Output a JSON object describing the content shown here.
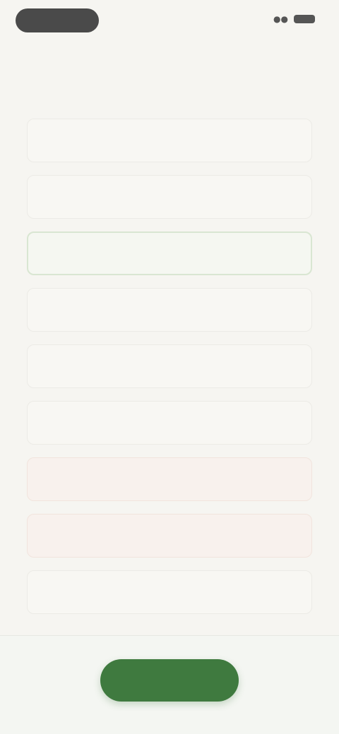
{
  "status_bar": {
    "pill_label": "",
    "time": "",
    "signal_icon": "signal-icon",
    "battery_icon": "battery-icon"
  },
  "question": "",
  "options": [
    {
      "icon": "",
      "icon_name": "option-icon",
      "label": ""
    },
    {
      "icon": "",
      "icon_name": "option-icon",
      "label": ""
    },
    {
      "icon": "",
      "icon_name": "option-icon",
      "label": ""
    },
    {
      "icon": "",
      "icon_name": "option-icon",
      "label": ""
    },
    {
      "icon": "",
      "icon_name": "option-icon",
      "label": ""
    },
    {
      "icon": "",
      "icon_name": "option-icon",
      "label": ""
    },
    {
      "icon": "",
      "icon_name": "option-icon",
      "label": ""
    },
    {
      "icon": "",
      "icon_name": "option-icon",
      "label": ""
    },
    {
      "icon": "",
      "icon_name": "option-icon",
      "label": ""
    }
  ],
  "continue_label": "",
  "colors": {
    "background": "#f6f5f1",
    "accent": "#3f7a3f",
    "warning": "#c05555"
  }
}
